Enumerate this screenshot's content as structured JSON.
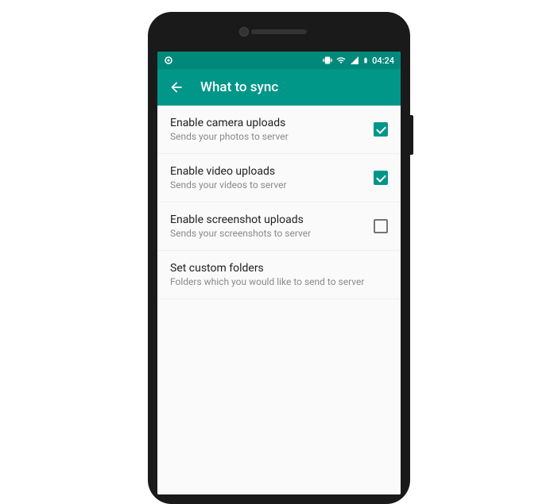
{
  "statusBar": {
    "time": "04:24"
  },
  "appBar": {
    "title": "What to sync"
  },
  "settings": [
    {
      "title": "Enable camera uploads",
      "subtitle": "Sends your photos to server",
      "checked": true,
      "hasCheckbox": true
    },
    {
      "title": "Enable video uploads",
      "subtitle": "Sends your videos to server",
      "checked": true,
      "hasCheckbox": true
    },
    {
      "title": "Enable screenshot uploads",
      "subtitle": "Sends your screenshots to server",
      "checked": false,
      "hasCheckbox": true
    },
    {
      "title": "Set custom folders",
      "subtitle": "Folders which you would like to send to server",
      "hasCheckbox": false
    }
  ]
}
